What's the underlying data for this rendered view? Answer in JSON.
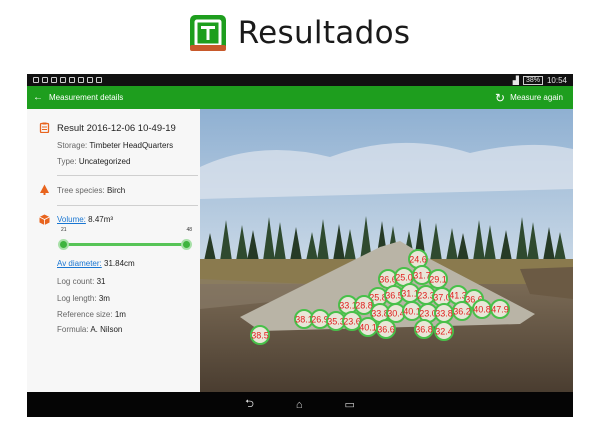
{
  "slide": {
    "title": "Resultados",
    "logo_icon": "timbeter-logo-icon",
    "accent": "#1e9e1e"
  },
  "status_bar": {
    "battery": "38%",
    "time": "10:54"
  },
  "app_bar": {
    "back_icon": "back-arrow-icon",
    "title": "Measurement details",
    "action_label": "Measure again",
    "action_icon": "refresh-icon"
  },
  "details": {
    "result": "Result 2016-12-06 10-49-19",
    "storage_label": "Storage:",
    "storage_value": "Timbeter HeadQuarters",
    "type_label": "Type:",
    "type_value": "Uncategorized",
    "species_label": "Tree species:",
    "species_value": "Birch",
    "volume_label": "Volume:",
    "volume_value": "8.47m³",
    "slider_min": "21",
    "slider_max": "48",
    "av_diameter_label": "Av diameter:",
    "av_diameter_value": "31.84cm",
    "log_count_label": "Log count:",
    "log_count_value": "31",
    "log_length_label": "Log length:",
    "log_length_value": "3m",
    "reference_label": "Reference size:",
    "reference_value": "1m",
    "formula_label": "Formula:",
    "formula_value": "A. Nilson"
  },
  "log_labels": [
    "24.6",
    "36.6",
    "25.0",
    "31.7",
    "29.1",
    "25.8",
    "36.5",
    "31.1",
    "23.3",
    "37.0",
    "41.3",
    "36.6",
    "33.1",
    "28.8",
    "33.8",
    "30.4",
    "40.1",
    "23.0",
    "33.8",
    "36.2",
    "40.8",
    "47.9",
    "38.1",
    "26.9",
    "35.3",
    "23.6",
    "40.1",
    "36.6",
    "36.8",
    "32.4",
    "38.5"
  ],
  "nav": {
    "back": "⮌",
    "home": "⌂",
    "recents": "▭"
  }
}
